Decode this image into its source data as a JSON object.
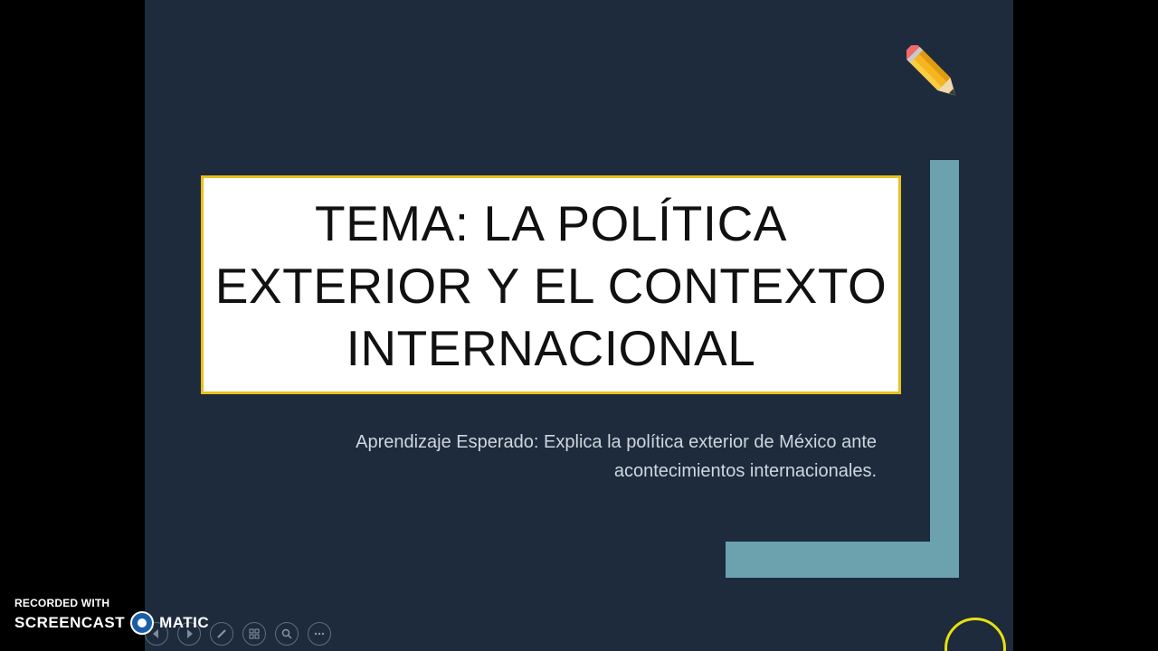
{
  "slide": {
    "title_lines": [
      "TEMA: LA POLÍTICA",
      "EXTERIOR Y EL CONTEXTO",
      "INTERNACIONAL"
    ],
    "subtitle_lines": [
      "Aprendizaje Esperado: Explica la política exterior de México ante",
      "acontecimientos internacionales."
    ]
  },
  "toolbar": {
    "buttons": [
      "previous",
      "next",
      "pen",
      "slides",
      "zoom",
      "more"
    ]
  },
  "watermark": {
    "top": "RECORDED WITH",
    "left": "SCREENCAST",
    "right": "MATIC"
  },
  "colors": {
    "slide_bg": "#1d2b3c",
    "accent_frame": "#6ca1ae",
    "title_border": "#e6c020",
    "cursor_highlight": "#e8e010"
  },
  "icons": {
    "decoration": "pencil-icon"
  }
}
